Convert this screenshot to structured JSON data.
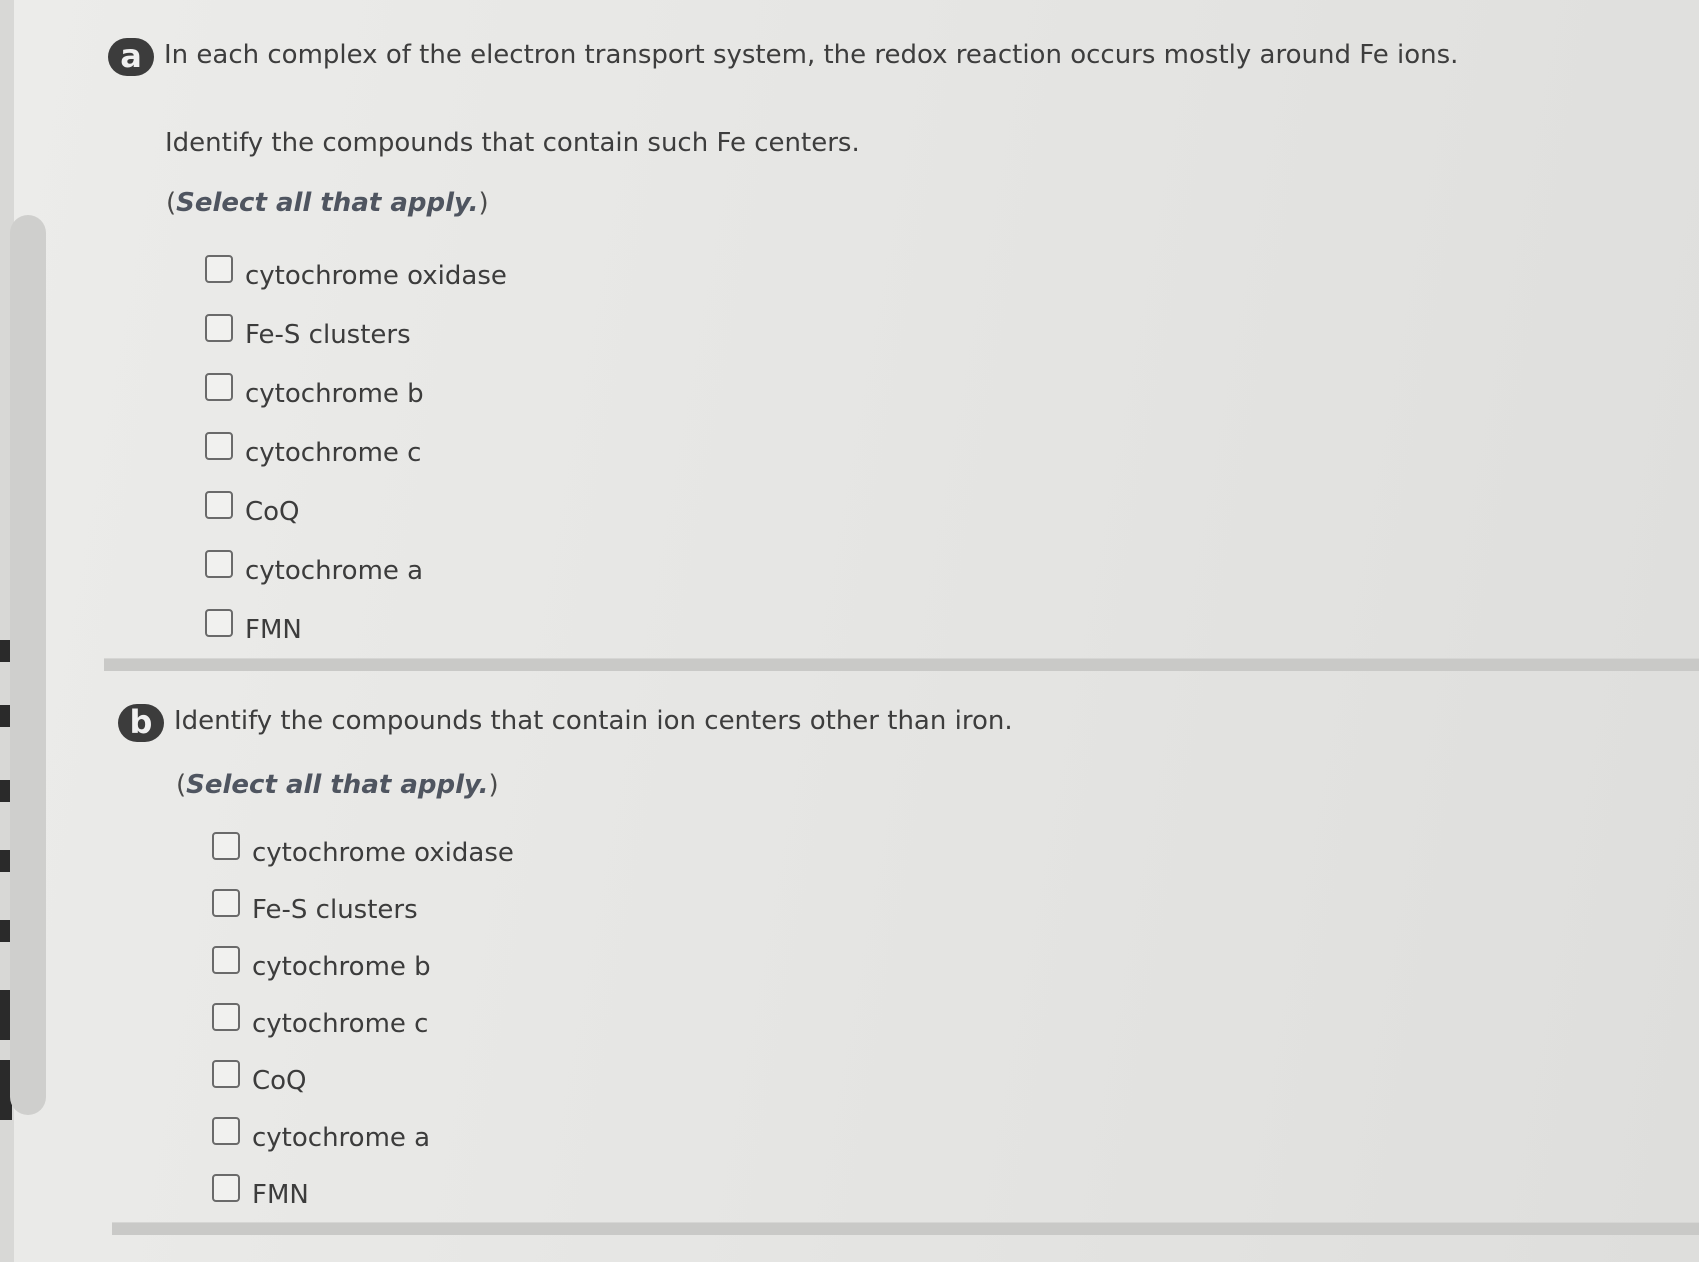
{
  "question_a": {
    "badge": "a",
    "prompt": "In each complex of the electron transport system, the redox reaction occurs mostly around Fe ions.",
    "sub_prompt": "Identify the compounds that contain such Fe centers.",
    "instruction_open": "(",
    "instruction_emphasis": "Select all that apply.",
    "instruction_close": ")",
    "options": [
      {
        "label": "cytochrome oxidase",
        "checked": false
      },
      {
        "label": "Fe-S clusters",
        "checked": false
      },
      {
        "label": "cytochrome b",
        "checked": false
      },
      {
        "label": "cytochrome c",
        "checked": false
      },
      {
        "label": "CoQ",
        "checked": false
      },
      {
        "label": "cytochrome a",
        "checked": false
      },
      {
        "label": "FMN",
        "checked": false
      }
    ]
  },
  "question_b": {
    "badge": "b",
    "prompt": "Identify the compounds that contain ion centers other than iron.",
    "instruction_open": "(",
    "instruction_emphasis": "Select all that apply.",
    "instruction_close": ")",
    "options": [
      {
        "label": "cytochrome oxidase",
        "checked": false
      },
      {
        "label": "Fe-S clusters",
        "checked": false
      },
      {
        "label": "cytochrome b",
        "checked": false
      },
      {
        "label": "cytochrome c",
        "checked": false
      },
      {
        "label": "CoQ",
        "checked": false
      },
      {
        "label": "cytochrome a",
        "checked": false
      },
      {
        "label": "FMN",
        "checked": false
      }
    ]
  }
}
